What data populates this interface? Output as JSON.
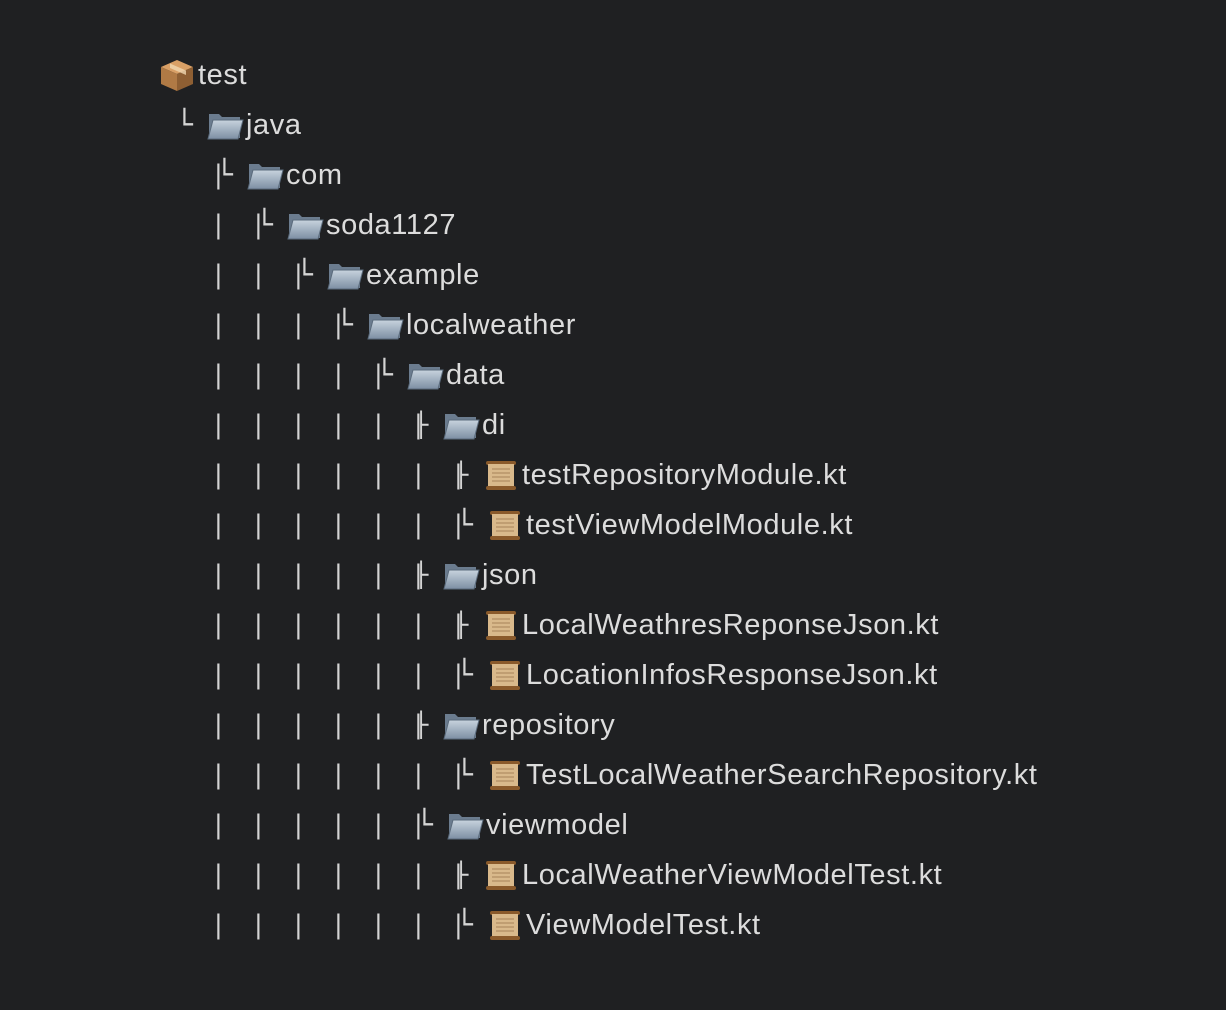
{
  "tree": {
    "connectors": {
      "pipe": "|",
      "tee": "├",
      "elbow": "└"
    },
    "nodes": [
      {
        "label": "test",
        "kind": "package",
        "depth": 0,
        "branch": "",
        "guides": []
      },
      {
        "label": "java",
        "kind": "folder",
        "depth": 1,
        "branch": "└",
        "guides": []
      },
      {
        "label": "com",
        "kind": "folder",
        "depth": 2,
        "branch": "└",
        "guides": [
          1
        ]
      },
      {
        "label": "soda1127",
        "kind": "folder",
        "depth": 3,
        "branch": "└",
        "guides": [
          1,
          2
        ]
      },
      {
        "label": "example",
        "kind": "folder",
        "depth": 4,
        "branch": "└",
        "guides": [
          1,
          2,
          3
        ]
      },
      {
        "label": "localweather",
        "kind": "folder",
        "depth": 5,
        "branch": "└",
        "guides": [
          1,
          2,
          3,
          4
        ]
      },
      {
        "label": "data",
        "kind": "folder",
        "depth": 6,
        "branch": "└",
        "guides": [
          1,
          2,
          3,
          4,
          5
        ]
      },
      {
        "label": "di",
        "kind": "folder",
        "depth": 7,
        "branch": "├",
        "guides": [
          1,
          2,
          3,
          4,
          5,
          6
        ]
      },
      {
        "label": "testRepositoryModule.kt",
        "kind": "file",
        "depth": 8,
        "branch": "├",
        "guides": [
          1,
          2,
          3,
          4,
          5,
          6,
          7
        ]
      },
      {
        "label": "testViewModelModule.kt",
        "kind": "file",
        "depth": 8,
        "branch": "└",
        "guides": [
          1,
          2,
          3,
          4,
          5,
          6,
          7
        ]
      },
      {
        "label": "json",
        "kind": "folder",
        "depth": 7,
        "branch": "├",
        "guides": [
          1,
          2,
          3,
          4,
          5,
          6
        ]
      },
      {
        "label": "LocalWeathresReponseJson.kt",
        "kind": "file",
        "depth": 8,
        "branch": "├",
        "guides": [
          1,
          2,
          3,
          4,
          5,
          6,
          7
        ]
      },
      {
        "label": "LocationInfosResponseJson.kt",
        "kind": "file",
        "depth": 8,
        "branch": "└",
        "guides": [
          1,
          2,
          3,
          4,
          5,
          6,
          7
        ]
      },
      {
        "label": "repository",
        "kind": "folder",
        "depth": 7,
        "branch": "├",
        "guides": [
          1,
          2,
          3,
          4,
          5,
          6
        ]
      },
      {
        "label": "TestLocalWeatherSearchRepository.kt",
        "kind": "file",
        "depth": 8,
        "branch": "└",
        "guides": [
          1,
          2,
          3,
          4,
          5,
          6,
          7
        ]
      },
      {
        "label": "viewmodel",
        "kind": "folder",
        "depth": 7,
        "branch": "└",
        "guides": [
          1,
          2,
          3,
          4,
          5,
          6
        ]
      },
      {
        "label": "LocalWeatherViewModelTest.kt",
        "kind": "file",
        "depth": 8,
        "branch": "├",
        "guides": [
          1,
          2,
          3,
          4,
          5,
          6,
          7
        ]
      },
      {
        "label": "ViewModelTest.kt",
        "kind": "file",
        "depth": 8,
        "branch": "└",
        "guides": [
          1,
          2,
          3,
          4,
          5,
          6,
          7
        ]
      }
    ]
  },
  "icons": {
    "package": "package-icon",
    "folder": "folder-icon",
    "file": "scroll-icon"
  },
  "colors": {
    "background": "#1f2022",
    "text": "#dcdcdc",
    "folder": "#8fa3b8",
    "scroll": "#c9a77a",
    "package": "#b07a45"
  }
}
